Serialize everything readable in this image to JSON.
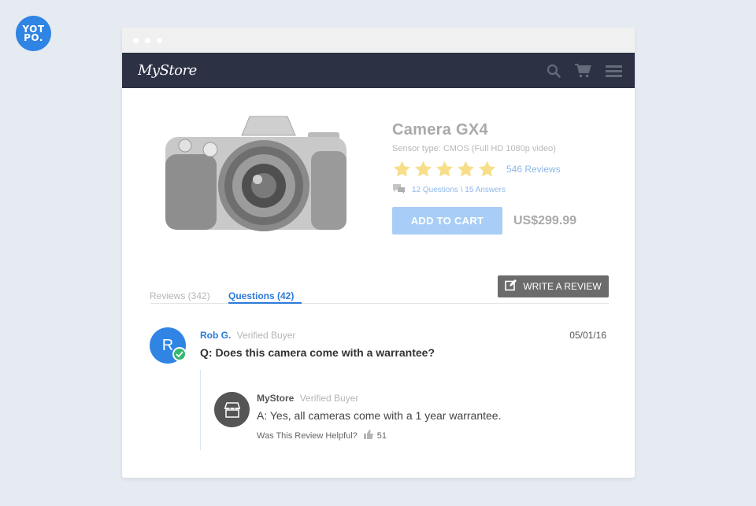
{
  "yotpo_logo": {
    "line1": "YOT",
    "line2": "PO."
  },
  "store": {
    "brand": "MyStore"
  },
  "product": {
    "title": "Camera GX4",
    "subtitle": "Sensor type: CMOS (Full HD 1080p video)",
    "rating": 5,
    "reviews_link": "546 Reviews",
    "qa_link": "12 Questions \\ 15 Answers",
    "add_to_cart": "ADD TO CART",
    "price": "US$299.99"
  },
  "tabs": {
    "reviews": "Reviews (342)",
    "questions": "Questions (42)",
    "write_review": "WRITE A REVIEW"
  },
  "question": {
    "avatar_letter": "R",
    "author": "Rob G.",
    "verified": "Verified Buyer",
    "date": "05/01/16",
    "text": "Q: Does this camera come with a warrantee?"
  },
  "answer": {
    "author": "MyStore",
    "verified": "Verified Buyer",
    "text": "A: Yes, all cameras come with a 1 year warrantee.",
    "helpful_label": "Was This Review Helpful?",
    "helpful_count": "51"
  },
  "colors": {
    "accent": "#2d7ad8",
    "navbar": "#2c3144",
    "star": "#f7df8a",
    "verified_check": "#33b86e"
  },
  "icons": [
    "search-icon",
    "cart-icon",
    "menu-icon",
    "chat-bubble-icon",
    "edit-icon",
    "check-icon",
    "storefront-icon",
    "thumbs-up-icon"
  ]
}
